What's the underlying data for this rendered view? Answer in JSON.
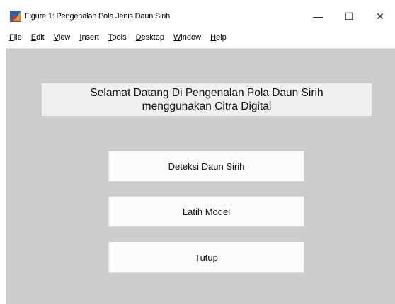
{
  "window": {
    "title": "Figure 1: Pengenalan Pola Jenis Daun Sirih",
    "minimize_glyph": "—",
    "maximize_glyph": "☐",
    "close_glyph": "✕"
  },
  "menubar": {
    "items": [
      {
        "key": "F",
        "rest": "ile"
      },
      {
        "key": "E",
        "rest": "dit"
      },
      {
        "key": "V",
        "rest": "iew"
      },
      {
        "key": "I",
        "rest": "nsert"
      },
      {
        "key": "T",
        "rest": "ools"
      },
      {
        "key": "D",
        "rest": "esktop"
      },
      {
        "key": "W",
        "rest": "indow"
      },
      {
        "key": "H",
        "rest": "elp"
      }
    ]
  },
  "main": {
    "welcome_line1": "Selamat Datang Di Pengenalan Pola Daun Sirih",
    "welcome_line2": "menggunakan Citra Digital",
    "buttons": {
      "detect": "Deteksi Daun Sirih",
      "train": "Latih Model",
      "close": "Tutup"
    }
  },
  "colors": {
    "figure_background": "#cdcdcd",
    "panel_background": "#f0f0f0",
    "icon_orange": "#e8891c",
    "icon_blue": "#2a5fb5"
  }
}
